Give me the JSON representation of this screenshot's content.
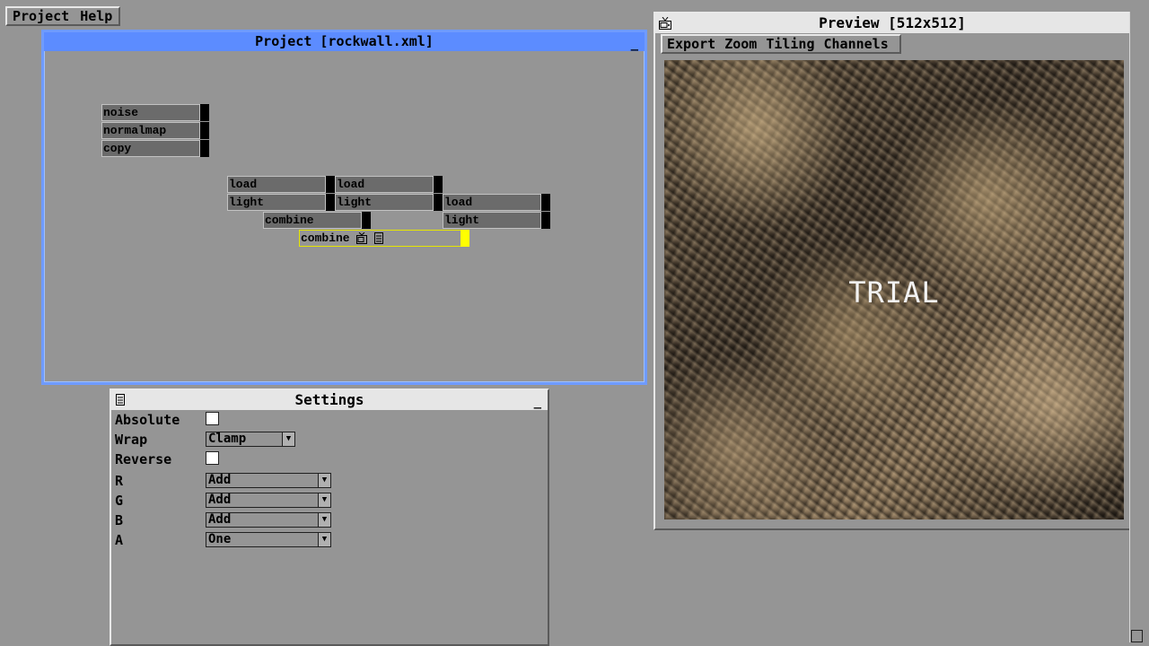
{
  "menubar": {
    "items": [
      "Project",
      "Help"
    ]
  },
  "project": {
    "title": "Project [rockwall.xml]",
    "minimize": "_",
    "nodes": {
      "noise": "noise",
      "normalmap": "normalmap",
      "copy": "copy",
      "load1": "load",
      "load2": "load",
      "load3": "load",
      "light1": "light",
      "light2": "light",
      "light3": "light",
      "combine1": "combine",
      "combine2": "combine"
    }
  },
  "settings": {
    "title": "Settings",
    "minimize": "_",
    "labels": {
      "absolute": "Absolute",
      "wrap": "Wrap",
      "reverse": "Reverse",
      "r": "R",
      "g": "G",
      "b": "B",
      "a": "A"
    },
    "values": {
      "wrap": "Clamp",
      "r": "Add",
      "g": "Add",
      "b": "Add",
      "a": "One"
    },
    "arrow": "▼"
  },
  "preview": {
    "title": "Preview [512x512]",
    "menu": [
      "Export",
      "Zoom",
      "Tiling",
      "Channels"
    ],
    "watermark": "TRIAL"
  },
  "colors": {
    "background": "#959595",
    "project_title_bar": "#5c8cff",
    "selected_node_outline": "#ffff00"
  }
}
